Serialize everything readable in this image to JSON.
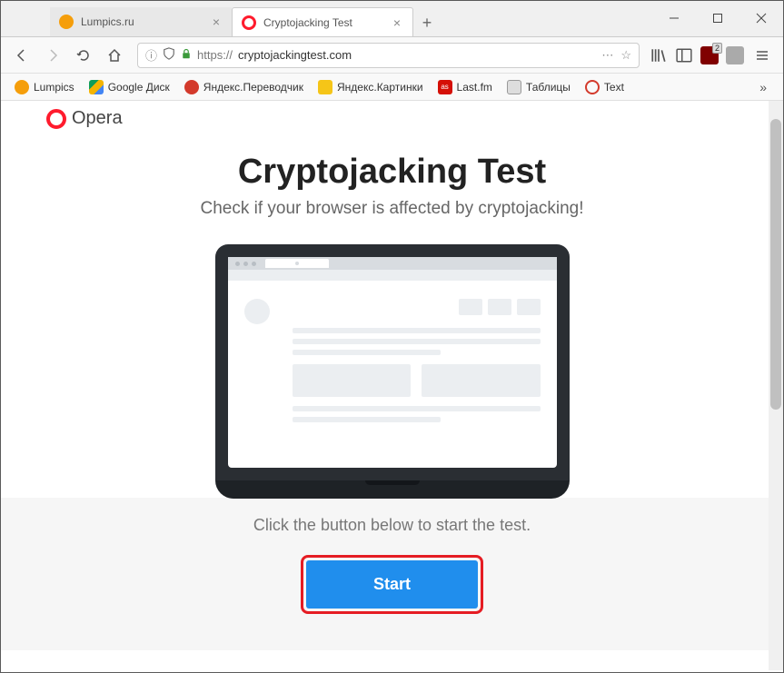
{
  "tabs": [
    {
      "label": "Lumpics.ru",
      "favicon_color": "#f59e0b",
      "active": false
    },
    {
      "label": "Cryptojacking Test",
      "favicon_color": "#ff1b2d",
      "active": true
    }
  ],
  "address_bar": {
    "prefix": "https://",
    "domain": "cryptojackingtest.com"
  },
  "ublock_badge": "2",
  "bookmarks": [
    {
      "label": "Lumpics",
      "color": "#f59e0b"
    },
    {
      "label": "Google Диск",
      "color": "#0f9d58"
    },
    {
      "label": "Яндекс.Переводчик",
      "color": "#d33a2c"
    },
    {
      "label": "Яндекс.Картинки",
      "color": "#f5c518"
    },
    {
      "label": "Last.fm",
      "color": "#d51007"
    },
    {
      "label": "Таблицы",
      "color": "#888"
    },
    {
      "label": "Text",
      "color": "#d33a2c"
    }
  ],
  "page": {
    "logo_text": "Opera",
    "title": "Cryptojacking Test",
    "subtitle": "Check if your browser is affected by cryptojacking!",
    "cta_instruction": "Click the button below to start the test.",
    "start_button": "Start"
  }
}
